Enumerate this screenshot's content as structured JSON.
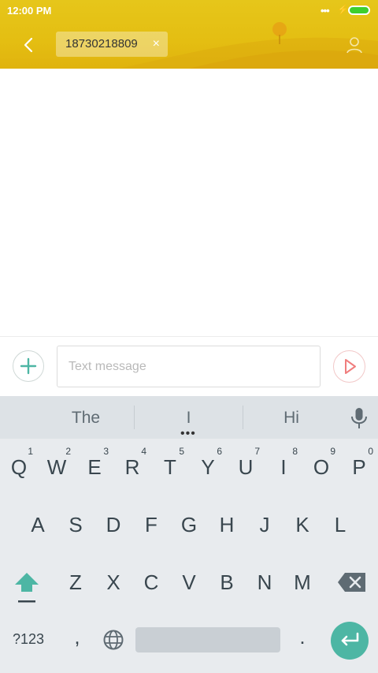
{
  "status_bar": {
    "time": "12:00 PM",
    "more_dots": "•••",
    "charging_symbol": "⚡"
  },
  "header": {
    "recipient": "18730218809",
    "remove_symbol": "×",
    "back_icon": "chevron-left-icon",
    "contact_icon": "person-icon"
  },
  "compose": {
    "placeholder": "Text message"
  },
  "keyboard": {
    "suggestions": [
      "The",
      "I",
      "Hi"
    ],
    "suggestion_dots": "•••",
    "row1": [
      {
        "label": "Q",
        "num": "1"
      },
      {
        "label": "W",
        "num": "2"
      },
      {
        "label": "E",
        "num": "3"
      },
      {
        "label": "R",
        "num": "4"
      },
      {
        "label": "T",
        "num": "5"
      },
      {
        "label": "Y",
        "num": "6"
      },
      {
        "label": "U",
        "num": "7"
      },
      {
        "label": "I",
        "num": "8"
      },
      {
        "label": "O",
        "num": "9"
      },
      {
        "label": "P",
        "num": "0"
      }
    ],
    "row2": [
      "A",
      "S",
      "D",
      "F",
      "G",
      "H",
      "J",
      "K",
      "L"
    ],
    "row3": [
      "Z",
      "X",
      "C",
      "V",
      "B",
      "N",
      "M"
    ],
    "symbols_key": "?123",
    "comma_key": ",",
    "period_key": "."
  },
  "colors": {
    "header": "#e4be12",
    "accent_teal": "#4db6a4",
    "send_red": "#f07e7e",
    "battery": "#3ecf2e"
  }
}
